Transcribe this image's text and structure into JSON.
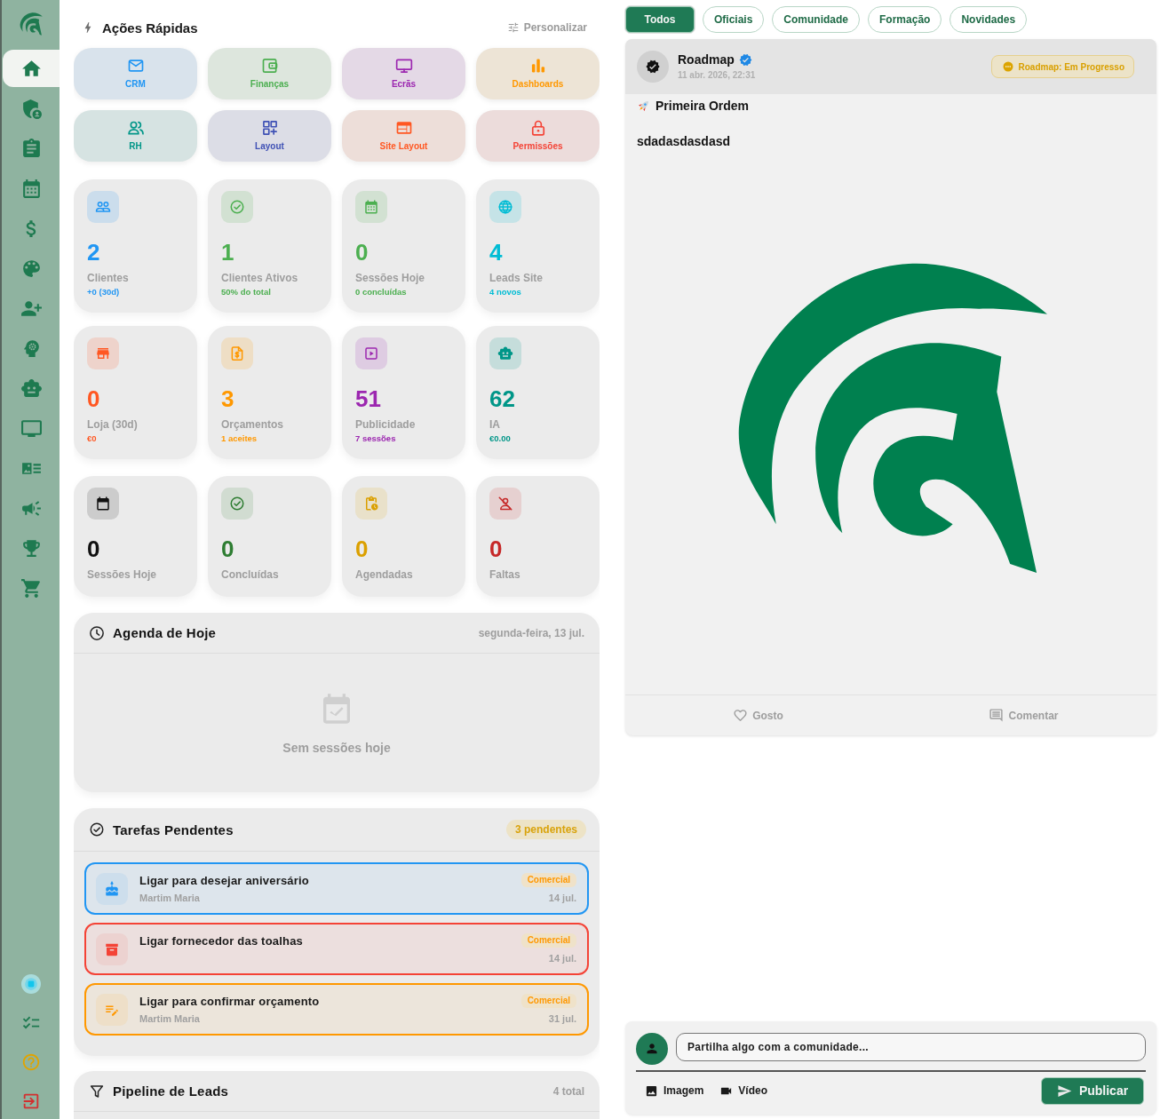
{
  "sidebar": {
    "nav_items": [
      {
        "selected": true
      },
      {
        "selected": false
      },
      {
        "selected": false
      },
      {
        "selected": false
      },
      {
        "selected": false
      },
      {
        "selected": false
      },
      {
        "selected": false
      },
      {
        "selected": false
      },
      {
        "selected": false
      },
      {
        "selected": false
      },
      {
        "selected": false
      },
      {
        "selected": false
      },
      {
        "selected": false
      },
      {
        "selected": false
      }
    ]
  },
  "quick_actions": {
    "title": "Ações Rápidas",
    "customize": "Personalizar",
    "items": [
      {
        "label": "CRM",
        "color": "#2196f3"
      },
      {
        "label": "Finanças",
        "color": "#4caf50"
      },
      {
        "label": "Ecrãs",
        "color": "#9c27b0"
      },
      {
        "label": "Dashboards",
        "color": "#ff9800"
      },
      {
        "label": "RH",
        "color": "#009688"
      },
      {
        "label": "Layout",
        "color": "#3f51b5"
      },
      {
        "label": "Site Layout",
        "color": "#ff5722"
      },
      {
        "label": "Permissões",
        "color": "#f44336"
      }
    ]
  },
  "stats": [
    {
      "value": "2",
      "label": "Clientes",
      "sub": "+0 (30d)",
      "color": "#2196f3"
    },
    {
      "value": "1",
      "label": "Clientes Ativos",
      "sub": "50% do total",
      "color": "#4caf50"
    },
    {
      "value": "0",
      "label": "Sessões Hoje",
      "sub": "0 concluídas",
      "color": "#4caf50"
    },
    {
      "value": "4",
      "label": "Leads Site",
      "sub": "4 novos",
      "color": "#00bcd4"
    },
    {
      "value": "0",
      "label": "Loja (30d)",
      "sub": "€0",
      "color": "#ff5722"
    },
    {
      "value": "3",
      "label": "Orçamentos",
      "sub": "1 aceites",
      "color": "#ff9800"
    },
    {
      "value": "51",
      "label": "Publicidade",
      "sub": "7 sessões",
      "color": "#9c27b0"
    },
    {
      "value": "62",
      "label": "IA",
      "sub": "€0.00",
      "color": "#009688"
    }
  ],
  "session_stats": [
    {
      "value": "0",
      "label": "Sessões Hoje",
      "color": "#111111"
    },
    {
      "value": "0",
      "label": "Concluídas",
      "color": "#2e7d32"
    },
    {
      "value": "0",
      "label": "Agendadas",
      "color": "#dba000"
    },
    {
      "value": "0",
      "label": "Faltas",
      "color": "#c62828"
    }
  ],
  "agenda": {
    "title": "Agenda de Hoje",
    "date": "segunda-feira, 13 jul.",
    "empty": "Sem sessões hoje"
  },
  "tasks": {
    "title": "Tarefas Pendentes",
    "badge": "3 pendentes",
    "items": [
      {
        "title": "Ligar para desejar aniversário",
        "person": "Martim Maria",
        "tag": "Comercial",
        "date": "14 jul.",
        "color": "#2196f3"
      },
      {
        "title": "Ligar fornecedor das toalhas",
        "tag": "Comercial",
        "date": "14 jul.",
        "color": "#f44336"
      },
      {
        "title": "Ligar para confirmar orçamento",
        "person": "Martim Maria",
        "tag": "Comercial",
        "date": "31 jul.",
        "color": "#ff9800"
      }
    ]
  },
  "pipeline": {
    "title": "Pipeline de Leads",
    "count": "4 total"
  },
  "feed": {
    "filters": [
      {
        "label": "Todos",
        "selected": true
      },
      {
        "label": "Oficiais",
        "selected": false
      },
      {
        "label": "Comunidade",
        "selected": false
      },
      {
        "label": "Formação",
        "selected": false
      },
      {
        "label": "Novidades",
        "selected": false
      }
    ],
    "post": {
      "author": "Roadmap",
      "verified": true,
      "time": "11 abr. 2026, 22:31",
      "status": "Roadmap: Em Progresso",
      "title": "Primeira Ordem",
      "body": "sdadasdasdasd",
      "actions": [
        "Gosto",
        "Comentar"
      ]
    }
  },
  "composer": {
    "placeholder": "Partilha algo com a comunidade...",
    "attachments": [
      "Imagem",
      "Vídeo"
    ],
    "submit": "Publicar"
  }
}
